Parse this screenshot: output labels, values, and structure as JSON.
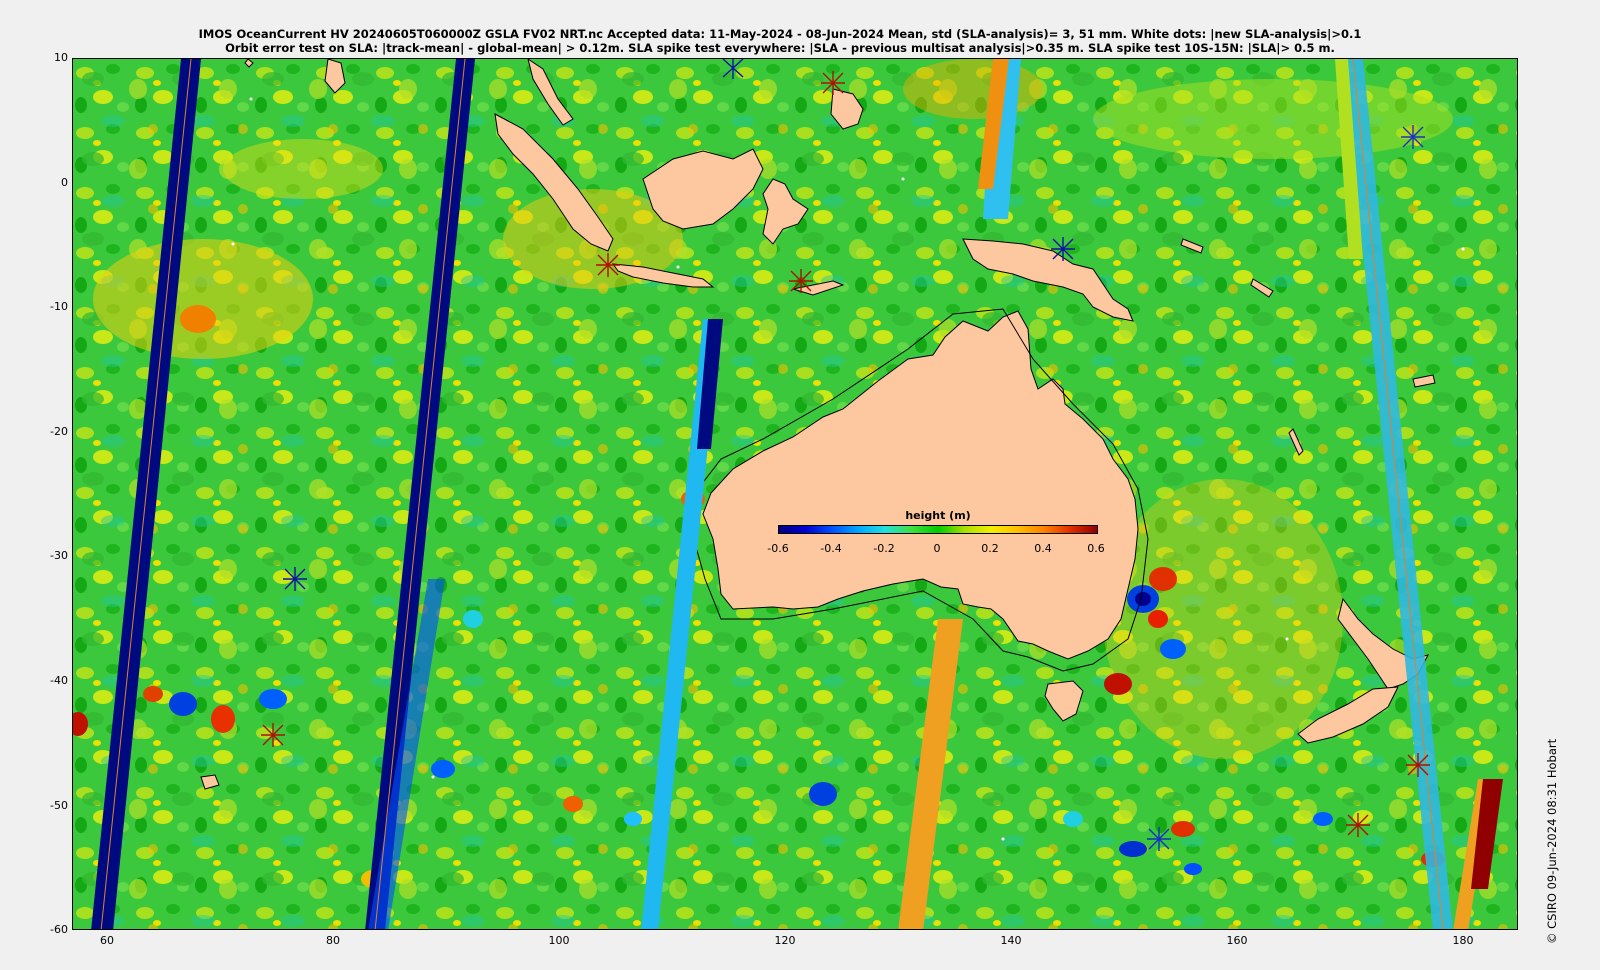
{
  "title_line1": "IMOS OceanCurrent HV 20240605T060000Z GSLA FV02 NRT.nc  Accepted data: 11-May-2024 - 08-Jun-2024 Mean, std (SLA-analysis)= 3, 51 mm. White dots: |new SLA-analysis|>0.1",
  "title_line2": "Orbit error test on SLA: |track-mean| - global-mean| > 0.12m.  SLA spike test everywhere: |SLA - previous multisat analysis|>0.35 m. SLA spike test 10S-15N: |SLA|> 0.5 m.",
  "copyright": "© CSIRO 09-Jun-2024 08:31 Hobart",
  "axes": {
    "lon_range": [
      57,
      185
    ],
    "lat_range": [
      -60,
      10
    ],
    "x_ticks": [
      "60",
      "80",
      "100",
      "120",
      "140",
      "160",
      "180"
    ],
    "y_ticks": [
      "10",
      "0",
      "-10",
      "-20",
      "-30",
      "-40",
      "-50",
      "-60"
    ]
  },
  "colorbar": {
    "title": "height (m)",
    "ticks": [
      "-0.6",
      "-0.4",
      "-0.2",
      "0",
      "0.2",
      "0.4",
      "0.6"
    ],
    "range": [
      -0.6,
      0.6
    ],
    "colors": [
      "#00007f",
      "#0050ff",
      "#20e0e0",
      "#00cc00",
      "#f0f000",
      "#ff8000",
      "#900000"
    ]
  },
  "colors": {
    "land": "#fdc8a0",
    "ocean_base": "#3cc83c",
    "track_blue": "#000a80",
    "track_orange": "#f0a020"
  }
}
